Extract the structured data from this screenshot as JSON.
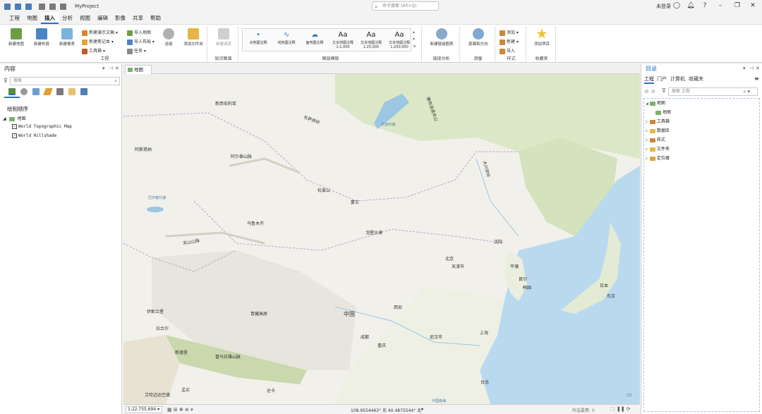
{
  "titlebar": {
    "project": "MyProject",
    "command_search_placeholder": "命令搜索 (Alt+Q)",
    "user_status": "未登录"
  },
  "menu": [
    "工程",
    "地图",
    "插入",
    "分析",
    "视图",
    "编辑",
    "影像",
    "共享",
    "帮助"
  ],
  "menu_active": "插入",
  "ribbon": {
    "project_group": {
      "label": "工程",
      "new_map": "新建地图",
      "new_layout": "新建布局",
      "new_report": "新建报表",
      "new_presentation": "新建演示文稿",
      "new_notebook": "新建笔记本",
      "toolbox": "工具箱",
      "import_map": "导入地图",
      "import_layout": "导入布局",
      "task": "任务",
      "connection": "连接",
      "add_folder": "添加文件夹"
    },
    "knowledge_group": {
      "label": "知识图谱",
      "new_investigation": "新建调查"
    },
    "layer_templates_group": {
      "label": "图层模板",
      "items": [
        {
          "label": "点地图注释",
          "sym": "•"
        },
        {
          "label": "线地图注释",
          "sym": "∿"
        },
        {
          "label": "面地图注释",
          "sym": "☁"
        },
        {
          "label": "文本地图注释\n1:1,000",
          "sym": "Aa"
        },
        {
          "label": "文本地图注释\n1:25,000",
          "sym": "Aa"
        },
        {
          "label": "文本地图注释\n1:250,000",
          "sym": "Aa"
        }
      ]
    },
    "link_analysis_group": {
      "label": "链接分析",
      "new_link_chart": "新建链接图表"
    },
    "measure_group": {
      "label": "测量",
      "distance_direction": "距离和方向"
    },
    "style_group": {
      "label": "样式",
      "add": "添加",
      "new": "新建",
      "import": "导入"
    },
    "favorites_group": {
      "label": "收藏夹",
      "add_item": "添加项目"
    }
  },
  "contents_pane": {
    "title": "内容",
    "search_placeholder": "搜索",
    "drawing_order": "绘制顺序",
    "map_name": "地图",
    "layers": [
      "World Topographic Map",
      "World Hillshade"
    ]
  },
  "map_view": {
    "tab_label": "地图",
    "labels": [
      {
        "text": "新西伯利亚",
        "id": "novosibirsk"
      },
      {
        "text": "阿斯塔纳",
        "id": "astana"
      },
      {
        "text": "东萨彦岭",
        "id": "esayan"
      },
      {
        "text": "阿尔泰山脉",
        "id": "altai"
      },
      {
        "text": "杭爱山",
        "id": "hangai"
      },
      {
        "text": "蒙古",
        "id": "mongolia"
      },
      {
        "text": "乌鲁木齐",
        "id": "urumqi"
      },
      {
        "text": "戈壁沙漠",
        "id": "gobi"
      },
      {
        "text": "天山山脉",
        "id": "tianshan"
      },
      {
        "text": "大兴安岭",
        "id": "dxal"
      },
      {
        "text": "沈阳",
        "id": "shenyang"
      },
      {
        "text": "北京",
        "id": "beijing"
      },
      {
        "text": "天津市",
        "id": "tianjin"
      },
      {
        "text": "平壤",
        "id": "pyongyang"
      },
      {
        "text": "首尔",
        "id": "seoul"
      },
      {
        "text": "韩国",
        "id": "korea"
      },
      {
        "text": "日本",
        "id": "japan"
      },
      {
        "text": "东京",
        "id": "tokyo"
      },
      {
        "text": "青藏高原",
        "id": "qtplateau"
      },
      {
        "text": "中国",
        "id": "china"
      },
      {
        "text": "西安",
        "id": "xian"
      },
      {
        "text": "伊斯兰堡",
        "id": "islamabad"
      },
      {
        "text": "拉合尔",
        "id": "lahore"
      },
      {
        "text": "新德里",
        "id": "newdelhi"
      },
      {
        "text": "喜马拉雅山脉",
        "id": "himalaya"
      },
      {
        "text": "成都",
        "id": "chengdu"
      },
      {
        "text": "重庆",
        "id": "chongqing"
      },
      {
        "text": "武汉市",
        "id": "wuhan"
      },
      {
        "text": "上海",
        "id": "shanghai"
      },
      {
        "text": "台北",
        "id": "taipei"
      },
      {
        "text": "中国南海",
        "id": "scs"
      },
      {
        "text": "艾哈迈达巴德",
        "id": "ahmedabad"
      },
      {
        "text": "孟买",
        "id": "mumbai"
      },
      {
        "text": "达卡",
        "id": "dhaka"
      },
      {
        "text": "贝加尔湖",
        "id": "baikal"
      },
      {
        "text": "巴尔喀什湖",
        "id": "balkhash"
      },
      {
        "text": "雅布洛诺夫山",
        "id": "yablon"
      }
    ]
  },
  "statusbar": {
    "scale": "1:22,755,694",
    "coordinates": "108.9554463° 东  40.4875544° 北",
    "selected_features": "所选要素: 0"
  },
  "catalog_pane": {
    "title": "目录",
    "tabs": [
      "工程",
      "门户",
      "计算机",
      "收藏夹"
    ],
    "search_placeholder": "搜索 工程",
    "items": [
      {
        "label": "地图",
        "level": 0,
        "expanded": true
      },
      {
        "label": "地图",
        "level": 1
      },
      {
        "label": "工具箱",
        "level": 0
      },
      {
        "label": "数据库",
        "level": 0
      },
      {
        "label": "样式",
        "level": 0
      },
      {
        "label": "文件夹",
        "level": 0
      },
      {
        "label": "定位器",
        "level": 0
      }
    ]
  },
  "colors": {
    "accent": "#2a6fd1",
    "water": "#b9d9ef",
    "land": "#f1f0ea",
    "veg": "#dbe7c6"
  }
}
